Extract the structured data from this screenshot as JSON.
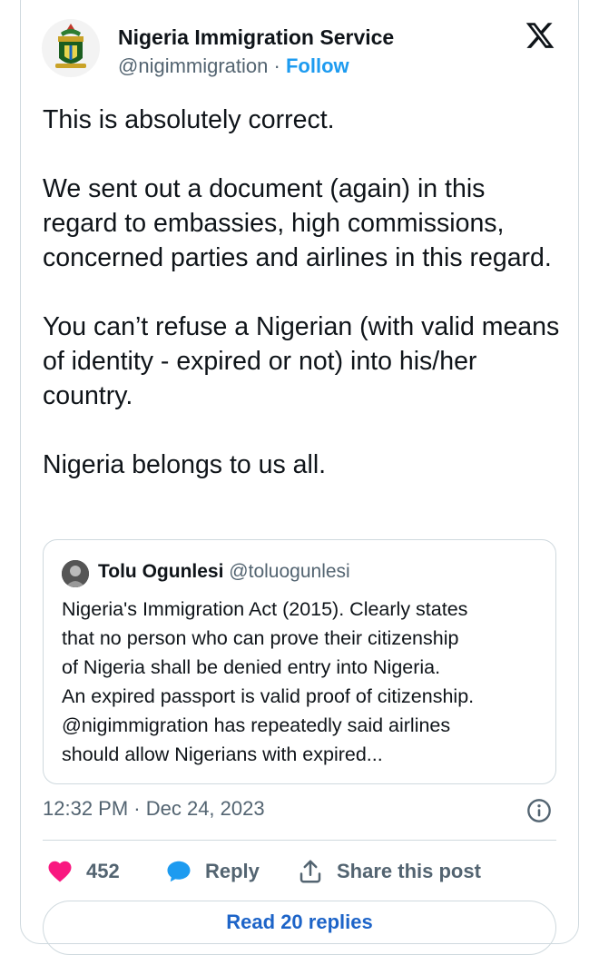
{
  "author": {
    "name": "Nigeria Immigration Service",
    "handle": "@nigimmigration",
    "separator": "·",
    "follow_label": "Follow",
    "avatar_icon": "nis-crest-logo"
  },
  "platform_icon": "x-logo-icon",
  "tweet": {
    "paragraphs": [
      "This is absolutely correct.",
      "We sent out a document (again) in this regard to embassies, high commissions, concerned parties and airlines in this regard.",
      "You can’t refuse a Nigerian (with valid means of identity - expired or not) into his/her country.",
      "Nigeria belongs to us all."
    ]
  },
  "quote": {
    "name": "Tolu Ogunlesi",
    "handle": "@toluogunlesi",
    "lines": [
      "Nigeria's Immigration Act (2015). Clearly states",
      "that no person who can prove their citizenship",
      "of Nigeria shall be denied entry into Nigeria.",
      "An expired passport is valid proof of citizenship.",
      "@nigimmigration has repeatedly said airlines",
      "should allow Nigerians with expired..."
    ]
  },
  "timestamp": "12:32 PM · Dec 24, 2023",
  "actions": {
    "like_count": "452",
    "reply_label": "Reply",
    "share_label": "Share this post"
  },
  "read_replies_label": "Read 20 replies",
  "colors": {
    "like": "#f91880",
    "accent": "#1d9bf0",
    "muted": "#536471",
    "border": "#cfd9de"
  }
}
